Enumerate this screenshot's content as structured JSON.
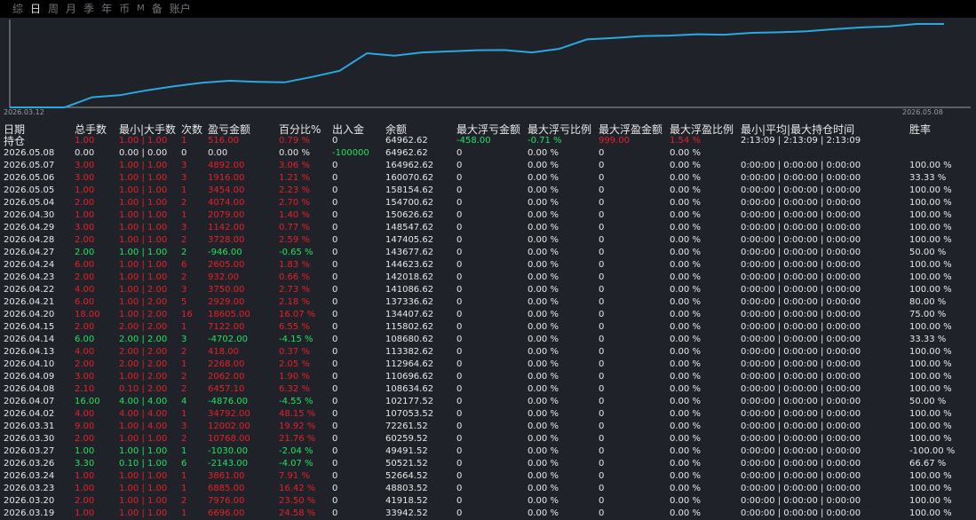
{
  "tabs": [
    {
      "label": "综",
      "active": false
    },
    {
      "label": "日",
      "active": true
    },
    {
      "label": "周",
      "active": false
    },
    {
      "label": "月",
      "active": false
    },
    {
      "label": "季",
      "active": false
    },
    {
      "label": "年",
      "active": false
    },
    {
      "label": "币",
      "active": false
    },
    {
      "label": "M",
      "active": false
    },
    {
      "label": "备",
      "active": false
    },
    {
      "label": "账户",
      "active": false
    }
  ],
  "colors": {
    "line": "#29a9e0",
    "red": "#e8202a",
    "green": "#22e25f",
    "bg": "#1f2228"
  },
  "chart_data": {
    "type": "line",
    "x_start_label": "2026.03.12",
    "x_end_label": "2026.05.08",
    "x": [
      "2026.03.12",
      "2026.03.13",
      "2026.03.16",
      "2026.03.17",
      "2026.03.18",
      "2026.03.19",
      "2026.03.20",
      "2026.03.23",
      "2026.03.24",
      "2026.03.26",
      "2026.03.27",
      "2026.03.30",
      "2026.03.31",
      "2026.04.02",
      "2026.04.07",
      "2026.04.08",
      "2026.04.09",
      "2026.04.10",
      "2026.04.13",
      "2026.04.14",
      "2026.04.15",
      "2026.04.20",
      "2026.04.21",
      "2026.04.22",
      "2026.04.23",
      "2026.04.24",
      "2026.04.27",
      "2026.04.28",
      "2026.04.29",
      "2026.04.30",
      "2026.05.04",
      "2026.05.05",
      "2026.05.06",
      "2026.05.07",
      "2026.05.08"
    ],
    "values": [
      0,
      0,
      0,
      20000,
      24000,
      33942.52,
      41918.52,
      48803.52,
      52664.52,
      50521.52,
      49491.52,
      60259.52,
      72261.52,
      107053.52,
      102177.52,
      108634.52,
      110696.52,
      112964.52,
      113382.52,
      108680.52,
      115802.62,
      134407.62,
      137336.62,
      141086.62,
      142018.62,
      144623.62,
      143677.62,
      147405.62,
      148547.62,
      150626.62,
      154700.62,
      158154.62,
      160070.62,
      164962.62,
      164962.62
    ]
  },
  "headers": {
    "date_line1": "日期",
    "date_line2": "持仓",
    "total_lots": "总手数",
    "min_max_lots": "最小|大手数",
    "count": "次数",
    "pnl": "盈亏金额",
    "pct": "百分比%",
    "cash": "出入金",
    "balance": "余额",
    "max_float_loss": "最大浮亏金额",
    "max_float_loss_pct": "最大浮亏比例",
    "max_float_profit": "最大浮盈金额",
    "max_float_profit_pct": "最大浮盈比例",
    "hold_time": "最小|平均|最大持仓时间",
    "winrate": "胜率"
  },
  "rows": [
    {
      "cells": [
        "",
        "1.00",
        "1.00 | 1.00",
        "1",
        "516.00",
        "0.79 %",
        "0",
        "64962.62",
        "-458.00",
        "-0.71 %",
        "999.00",
        "1.54 %",
        "2:13:09 | 2:13:09 | 2:13:09",
        ""
      ],
      "colors": [
        "white",
        "red",
        "red",
        "red",
        "red",
        "red",
        "white",
        "white",
        "green",
        "green",
        "red",
        "red",
        "white",
        "white"
      ]
    },
    {
      "cells": [
        "2026.05.08",
        "0.00",
        "0.00 | 0.00",
        "0",
        "0.00",
        "0.00 %",
        "-100000",
        "64962.62",
        "0",
        "0.00 %",
        "0",
        "0.00 %",
        "",
        ""
      ],
      "colors": [
        "white",
        "white",
        "white",
        "white",
        "white",
        "white",
        "green",
        "white",
        "white",
        "white",
        "white",
        "white",
        "white",
        "white"
      ]
    },
    {
      "cells": [
        "2026.05.07",
        "3.00",
        "1.00 | 1.00",
        "3",
        "4892.00",
        "3.06 %",
        "0",
        "164962.62",
        "0",
        "0.00 %",
        "0",
        "0.00 %",
        "0:00:00 | 0:00:00 | 0:00:00",
        "100.00 %"
      ],
      "c": "r"
    },
    {
      "cells": [
        "2026.05.06",
        "3.00",
        "1.00 | 1.00",
        "3",
        "1916.00",
        "1.21 %",
        "0",
        "160070.62",
        "0",
        "0.00 %",
        "0",
        "0.00 %",
        "0:00:00 | 0:00:00 | 0:00:00",
        "33.33 %"
      ],
      "c": "r"
    },
    {
      "cells": [
        "2026.05.05",
        "1.00",
        "1.00 | 1.00",
        "1",
        "3454.00",
        "2.23 %",
        "0",
        "158154.62",
        "0",
        "0.00 %",
        "0",
        "0.00 %",
        "0:00:00 | 0:00:00 | 0:00:00",
        "100.00 %"
      ],
      "c": "r"
    },
    {
      "cells": [
        "2026.05.04",
        "2.00",
        "1.00 | 1.00",
        "2",
        "4074.00",
        "2.70 %",
        "0",
        "154700.62",
        "0",
        "0.00 %",
        "0",
        "0.00 %",
        "0:00:00 | 0:00:00 | 0:00:00",
        "100.00 %"
      ],
      "c": "r"
    },
    {
      "cells": [
        "2026.04.30",
        "1.00",
        "1.00 | 1.00",
        "1",
        "2079.00",
        "1.40 %",
        "0",
        "150626.62",
        "0",
        "0.00 %",
        "0",
        "0.00 %",
        "0:00:00 | 0:00:00 | 0:00:00",
        "100.00 %"
      ],
      "c": "r"
    },
    {
      "cells": [
        "2026.04.29",
        "3.00",
        "1.00 | 1.00",
        "3",
        "1142.00",
        "0.77 %",
        "0",
        "148547.62",
        "0",
        "0.00 %",
        "0",
        "0.00 %",
        "0:00:00 | 0:00:00 | 0:00:00",
        "100.00 %"
      ],
      "c": "r"
    },
    {
      "cells": [
        "2026.04.28",
        "2.00",
        "1.00 | 1.00",
        "2",
        "3728.00",
        "2.59 %",
        "0",
        "147405.62",
        "0",
        "0.00 %",
        "0",
        "0.00 %",
        "0:00:00 | 0:00:00 | 0:00:00",
        "100.00 %"
      ],
      "c": "r"
    },
    {
      "cells": [
        "2026.04.27",
        "2.00",
        "1.00 | 1.00",
        "2",
        "-946.00",
        "-0.65 %",
        "0",
        "143677.62",
        "0",
        "0.00 %",
        "0",
        "0.00 %",
        "0:00:00 | 0:00:00 | 0:00:00",
        "50.00 %"
      ],
      "c": "g"
    },
    {
      "cells": [
        "2026.04.24",
        "6.00",
        "1.00 | 1.00",
        "6",
        "2605.00",
        "1.83 %",
        "0",
        "144623.62",
        "0",
        "0.00 %",
        "0",
        "0.00 %",
        "0:00:00 | 0:00:00 | 0:00:00",
        "100.00 %"
      ],
      "c": "r"
    },
    {
      "cells": [
        "2026.04.23",
        "2.00",
        "1.00 | 1.00",
        "2",
        "932.00",
        "0.66 %",
        "0",
        "142018.62",
        "0",
        "0.00 %",
        "0",
        "0.00 %",
        "0:00:00 | 0:00:00 | 0:00:00",
        "100.00 %"
      ],
      "c": "r"
    },
    {
      "cells": [
        "2026.04.22",
        "4.00",
        "1.00 | 2.00",
        "3",
        "3750.00",
        "2.73 %",
        "0",
        "141086.62",
        "0",
        "0.00 %",
        "0",
        "0.00 %",
        "0:00:00 | 0:00:00 | 0:00:00",
        "100.00 %"
      ],
      "c": "r"
    },
    {
      "cells": [
        "2026.04.21",
        "6.00",
        "1.00 | 2.00",
        "5",
        "2929.00",
        "2.18 %",
        "0",
        "137336.62",
        "0",
        "0.00 %",
        "0",
        "0.00 %",
        "0:00:00 | 0:00:00 | 0:00:00",
        "80.00 %"
      ],
      "c": "r"
    },
    {
      "cells": [
        "2026.04.20",
        "18.00",
        "1.00 | 2.00",
        "16",
        "18605.00",
        "16.07 %",
        "0",
        "134407.62",
        "0",
        "0.00 %",
        "0",
        "0.00 %",
        "0:00:00 | 0:00:00 | 0:00:00",
        "75.00 %"
      ],
      "c": "r"
    },
    {
      "cells": [
        "2026.04.15",
        "2.00",
        "2.00 | 2.00",
        "1",
        "7122.00",
        "6.55 %",
        "0",
        "115802.62",
        "0",
        "0.00 %",
        "0",
        "0.00 %",
        "0:00:00 | 0:00:00 | 0:00:00",
        "100.00 %"
      ],
      "c": "r"
    },
    {
      "cells": [
        "2026.04.14",
        "6.00",
        "2.00 | 2.00",
        "3",
        "-4702.00",
        "-4.15 %",
        "0",
        "108680.62",
        "0",
        "0.00 %",
        "0",
        "0.00 %",
        "0:00:00 | 0:00:00 | 0:00:00",
        "33.33 %"
      ],
      "c": "g"
    },
    {
      "cells": [
        "2026.04.13",
        "4.00",
        "2.00 | 2.00",
        "2",
        "418.00",
        "0.37 %",
        "0",
        "113382.62",
        "0",
        "0.00 %",
        "0",
        "0.00 %",
        "0:00:00 | 0:00:00 | 0:00:00",
        "100.00 %"
      ],
      "c": "r"
    },
    {
      "cells": [
        "2026.04.10",
        "2.00",
        "2.00 | 2.00",
        "1",
        "2268.00",
        "2.05 %",
        "0",
        "112964.62",
        "0",
        "0.00 %",
        "0",
        "0.00 %",
        "0:00:00 | 0:00:00 | 0:00:00",
        "100.00 %"
      ],
      "c": "r"
    },
    {
      "cells": [
        "2026.04.09",
        "3.00",
        "1.00 | 2.00",
        "2",
        "2062.00",
        "1.90 %",
        "0",
        "110696.62",
        "0",
        "0.00 %",
        "0",
        "0.00 %",
        "0:00:00 | 0:00:00 | 0:00:00",
        "100.00 %"
      ],
      "c": "r"
    },
    {
      "cells": [
        "2026.04.08",
        "2.10",
        "0.10 | 2.00",
        "2",
        "6457.10",
        "6.32 %",
        "0",
        "108634.62",
        "0",
        "0.00 %",
        "0",
        "0.00 %",
        "0:00:00 | 0:00:00 | 0:00:00",
        "100.00 %"
      ],
      "c": "r"
    },
    {
      "cells": [
        "2026.04.07",
        "16.00",
        "4.00 | 4.00",
        "4",
        "-4876.00",
        "-4.55 %",
        "0",
        "102177.52",
        "0",
        "0.00 %",
        "0",
        "0.00 %",
        "0:00:00 | 0:00:00 | 0:00:00",
        "50.00 %"
      ],
      "c": "g"
    },
    {
      "cells": [
        "2026.04.02",
        "4.00",
        "4.00 | 4.00",
        "1",
        "34792.00",
        "48.15 %",
        "0",
        "107053.52",
        "0",
        "0.00 %",
        "0",
        "0.00 %",
        "0:00:00 | 0:00:00 | 0:00:00",
        "100.00 %"
      ],
      "c": "r"
    },
    {
      "cells": [
        "2026.03.31",
        "9.00",
        "1.00 | 4.00",
        "3",
        "12002.00",
        "19.92 %",
        "0",
        "72261.52",
        "0",
        "0.00 %",
        "0",
        "0.00 %",
        "0:00:00 | 0:00:00 | 0:00:00",
        "100.00 %"
      ],
      "c": "r"
    },
    {
      "cells": [
        "2026.03.30",
        "2.00",
        "1.00 | 1.00",
        "2",
        "10768.00",
        "21.76 %",
        "0",
        "60259.52",
        "0",
        "0.00 %",
        "0",
        "0.00 %",
        "0:00:00 | 0:00:00 | 0:00:00",
        "100.00 %"
      ],
      "c": "r"
    },
    {
      "cells": [
        "2026.03.27",
        "1.00",
        "1.00 | 1.00",
        "1",
        "-1030.00",
        "-2.04 %",
        "0",
        "49491.52",
        "0",
        "0.00 %",
        "0",
        "0.00 %",
        "0:00:00 | 0:00:00 | 0:00:00",
        "-100.00 %"
      ],
      "c": "g"
    },
    {
      "cells": [
        "2026.03.26",
        "3.30",
        "0.10 | 1.00",
        "6",
        "-2143.00",
        "-4.07 %",
        "0",
        "50521.52",
        "0",
        "0.00 %",
        "0",
        "0.00 %",
        "0:00:00 | 0:00:00 | 0:00:00",
        "66.67 %"
      ],
      "c": "g"
    },
    {
      "cells": [
        "2026.03.24",
        "1.00",
        "1.00 | 1.00",
        "1",
        "3861.00",
        "7.91 %",
        "0",
        "52664.52",
        "0",
        "0.00 %",
        "0",
        "0.00 %",
        "0:00:00 | 0:00:00 | 0:00:00",
        "100.00 %"
      ],
      "c": "r"
    },
    {
      "cells": [
        "2026.03.23",
        "1.00",
        "1.00 | 1.00",
        "1",
        "6885.00",
        "16.42 %",
        "0",
        "48803.52",
        "0",
        "0.00 %",
        "0",
        "0.00 %",
        "0:00:00 | 0:00:00 | 0:00:00",
        "100.00 %"
      ],
      "c": "r"
    },
    {
      "cells": [
        "2026.03.20",
        "2.00",
        "1.00 | 1.00",
        "2",
        "7976.00",
        "23.50 %",
        "0",
        "41918.52",
        "0",
        "0.00 %",
        "0",
        "0.00 %",
        "0:00:00 | 0:00:00 | 0:00:00",
        "100.00 %"
      ],
      "c": "r"
    },
    {
      "cells": [
        "2026.03.19",
        "1.00",
        "1.00 | 1.00",
        "1",
        "6696.00",
        "24.58 %",
        "0",
        "33942.52",
        "0",
        "0.00 %",
        "0",
        "0.00 %",
        "0:00:00 | 0:00:00 | 0:00:00",
        "100.00 %"
      ],
      "c": "r"
    }
  ]
}
